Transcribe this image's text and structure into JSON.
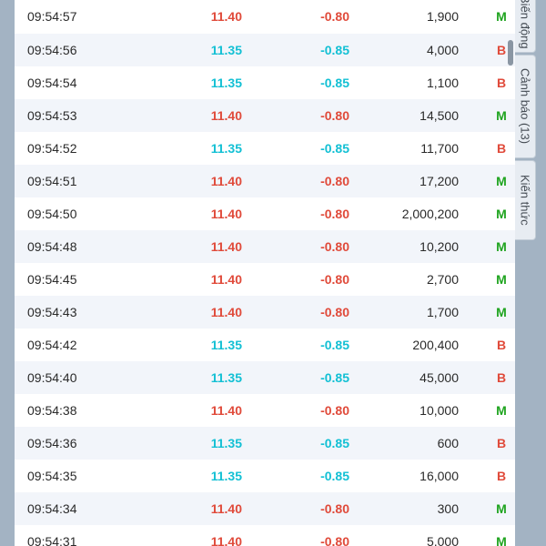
{
  "tabs": [
    {
      "label": "Biến động"
    },
    {
      "label": "Cảnh báo (13)"
    },
    {
      "label": "Kiến thức"
    }
  ],
  "colors": {
    "buy": "#1fa41f",
    "sell": "#e04a3a",
    "price_down": "#e04a3a",
    "price_cyan": "#13c0d4"
  },
  "trades": [
    {
      "time": "09:54:57",
      "price": "11.40",
      "change": "-0.80",
      "volume": "1,900",
      "side": "M"
    },
    {
      "time": "09:54:56",
      "price": "11.35",
      "change": "-0.85",
      "volume": "4,000",
      "side": "B"
    },
    {
      "time": "09:54:54",
      "price": "11.35",
      "change": "-0.85",
      "volume": "1,100",
      "side": "B"
    },
    {
      "time": "09:54:53",
      "price": "11.40",
      "change": "-0.80",
      "volume": "14,500",
      "side": "M"
    },
    {
      "time": "09:54:52",
      "price": "11.35",
      "change": "-0.85",
      "volume": "11,700",
      "side": "B"
    },
    {
      "time": "09:54:51",
      "price": "11.40",
      "change": "-0.80",
      "volume": "17,200",
      "side": "M"
    },
    {
      "time": "09:54:50",
      "price": "11.40",
      "change": "-0.80",
      "volume": "2,000,200",
      "side": "M"
    },
    {
      "time": "09:54:48",
      "price": "11.40",
      "change": "-0.80",
      "volume": "10,200",
      "side": "M"
    },
    {
      "time": "09:54:45",
      "price": "11.40",
      "change": "-0.80",
      "volume": "2,700",
      "side": "M"
    },
    {
      "time": "09:54:43",
      "price": "11.40",
      "change": "-0.80",
      "volume": "1,700",
      "side": "M"
    },
    {
      "time": "09:54:42",
      "price": "11.35",
      "change": "-0.85",
      "volume": "200,400",
      "side": "B"
    },
    {
      "time": "09:54:40",
      "price": "11.35",
      "change": "-0.85",
      "volume": "45,000",
      "side": "B"
    },
    {
      "time": "09:54:38",
      "price": "11.40",
      "change": "-0.80",
      "volume": "10,000",
      "side": "M"
    },
    {
      "time": "09:54:36",
      "price": "11.35",
      "change": "-0.85",
      "volume": "600",
      "side": "B"
    },
    {
      "time": "09:54:35",
      "price": "11.35",
      "change": "-0.85",
      "volume": "16,000",
      "side": "B"
    },
    {
      "time": "09:54:34",
      "price": "11.40",
      "change": "-0.80",
      "volume": "300",
      "side": "M"
    },
    {
      "time": "09:54:31",
      "price": "11.40",
      "change": "-0.80",
      "volume": "5,000",
      "side": "M"
    }
  ]
}
